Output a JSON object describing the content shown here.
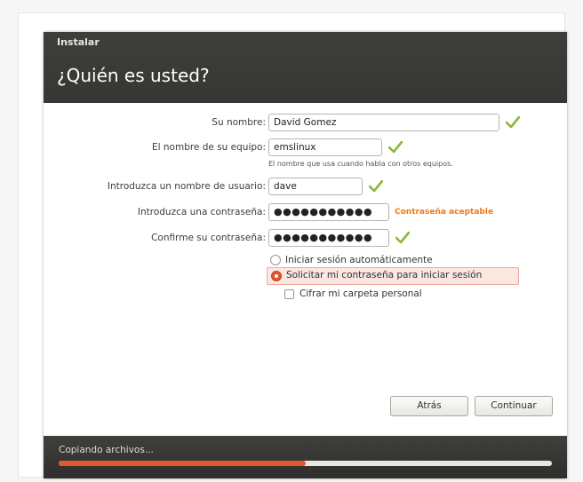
{
  "window": {
    "title": "Instalar",
    "heading": "¿Quién es usted?"
  },
  "form": {
    "name_label": "Su nombre:",
    "name_value": "David Gomez",
    "computer_label": "El nombre de su equipo:",
    "computer_value": "emslinux",
    "computer_hint": "El nombre que usa cuando habla con otros equipos.",
    "username_label": "Introduzca un nombre de usuario:",
    "username_value": "dave",
    "password_label": "Introduzca una contraseña:",
    "password_value": "●●●●●●●●●●●",
    "password_strength": "Contraseña aceptable",
    "confirm_label": "Confirme su contraseña:",
    "confirm_value": "●●●●●●●●●●●"
  },
  "options": {
    "auto_login": "Iniciar sesión automáticamente",
    "require_password": "Solicitar mi contraseña para iniciar sesión",
    "encrypt_home": "Cifrar mi carpeta personal",
    "selected": "require_password",
    "encrypt_checked": false
  },
  "buttons": {
    "back": "Atrás",
    "continue": "Continuar"
  },
  "footer": {
    "status": "Copiando archivos...",
    "progress": 0.5
  },
  "icons": {
    "valid": "check-icon"
  },
  "colors": {
    "accent": "#e05a2b",
    "check_green": "#8ab83a",
    "strength": "#f07a13",
    "header_bg": "#3c3b37"
  }
}
